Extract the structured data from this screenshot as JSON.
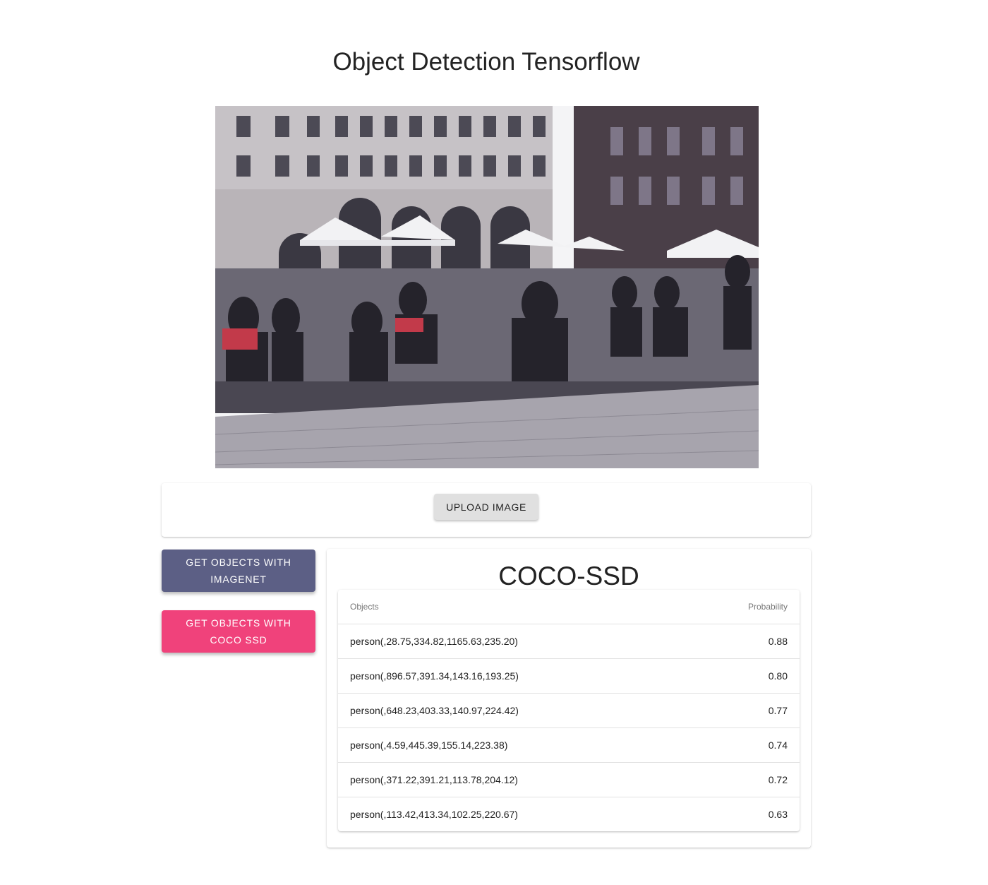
{
  "page": {
    "title": "Object Detection Tensorflow"
  },
  "upload": {
    "label": "Upload Image"
  },
  "actions": {
    "imagenet_label": "Get Objects with ImageNet",
    "coco_label": "Get Objects with COCO SSD"
  },
  "results": {
    "title": "COCO-SSD",
    "columns": {
      "objects": "Objects",
      "probability": "Probability"
    },
    "rows": [
      {
        "object": "person(,28.75,334.82,1165.63,235.20)",
        "probability": "0.88"
      },
      {
        "object": "person(,896.57,391.34,143.16,193.25)",
        "probability": "0.80"
      },
      {
        "object": "person(,648.23,403.33,140.97,224.42)",
        "probability": "0.77"
      },
      {
        "object": "person(,4.59,445.39,155.14,223.38)",
        "probability": "0.74"
      },
      {
        "object": "person(,371.22,391.21,113.78,204.12)",
        "probability": "0.72"
      },
      {
        "object": "person(,113.42,413.34,102.25,220.67)",
        "probability": "0.63"
      }
    ]
  },
  "colors": {
    "imagenet_button": "#5c5f85",
    "coco_button": "#f0427b",
    "upload_button": "#e0e0e0"
  }
}
